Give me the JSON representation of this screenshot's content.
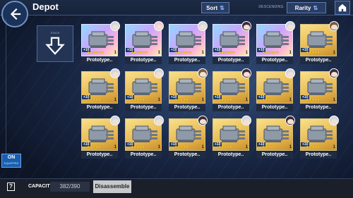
{
  "header": {
    "title": "Depot",
    "sort_label": "Sort",
    "descending_label": "DESCENDING",
    "rarity_label": "Rarity"
  },
  "equip_toggle": {
    "state": "ON",
    "sub": "EQUIPPED"
  },
  "collapse": {
    "tiny": "STACK"
  },
  "cards": [
    {
      "name": "Prototype..",
      "level": "+10",
      "count": "1",
      "stars": 6,
      "rarity": "prism",
      "avatar": "silver"
    },
    {
      "name": "Prototype..",
      "level": "+10",
      "count": "1",
      "stars": 6,
      "rarity": "prism",
      "avatar": "pink"
    },
    {
      "name": "Prototype..",
      "level": "+10",
      "count": "1",
      "stars": 6,
      "rarity": "prism",
      "avatar": "silver"
    },
    {
      "name": "Prototype..",
      "level": "+10",
      "count": "1",
      "stars": 6,
      "rarity": "prism",
      "avatar": "dark"
    },
    {
      "name": "Prototype..",
      "level": "+10",
      "count": "1",
      "stars": 6,
      "rarity": "prism",
      "avatar": "silver"
    },
    {
      "name": "Prototype..",
      "level": "+10",
      "count": "1",
      "stars": 5,
      "rarity": "gold",
      "avatar": "brown"
    },
    {
      "name": "Prototype..",
      "level": "+10",
      "count": "1",
      "stars": 5,
      "rarity": "gold",
      "avatar": "silver"
    },
    {
      "name": "Prototype..",
      "level": "+10",
      "count": "1",
      "stars": 5,
      "rarity": "gold",
      "avatar": "silver"
    },
    {
      "name": "Prototype..",
      "level": "+10",
      "count": "1",
      "stars": 5,
      "rarity": "gold",
      "avatar": "brown"
    },
    {
      "name": "Prototype..",
      "level": "+10",
      "count": "1",
      "stars": 5,
      "rarity": "gold",
      "avatar": "dark"
    },
    {
      "name": "Prototype..",
      "level": "+10",
      "count": "1",
      "stars": 5,
      "rarity": "gold",
      "avatar": "silver"
    },
    {
      "name": "Prototype..",
      "level": "+10",
      "count": "1",
      "stars": 5,
      "rarity": "gold",
      "avatar": "dark"
    },
    {
      "name": "Prototype..",
      "level": "+10",
      "count": "1",
      "stars": 5,
      "rarity": "gold",
      "avatar": "silver"
    },
    {
      "name": "Prototype..",
      "level": "+10",
      "count": "1",
      "stars": 5,
      "rarity": "gold",
      "avatar": "silver"
    },
    {
      "name": "Prototype..",
      "level": "+10",
      "count": "1",
      "stars": 5,
      "rarity": "gold",
      "avatar": "dark"
    },
    {
      "name": "Prototype..",
      "level": "+10",
      "count": "1",
      "stars": 5,
      "rarity": "gold",
      "avatar": "silver"
    },
    {
      "name": "Prototype..",
      "level": "+10",
      "count": "1",
      "stars": 5,
      "rarity": "gold",
      "avatar": "dark"
    },
    {
      "name": "Prototype..",
      "level": "+10",
      "count": "1",
      "stars": 5,
      "rarity": "gold",
      "avatar": "silver"
    }
  ],
  "footer": {
    "help": "?",
    "capacity_label": "CAPACITY",
    "capacity_value": "382/390",
    "disassemble_label": "Disassemble"
  }
}
